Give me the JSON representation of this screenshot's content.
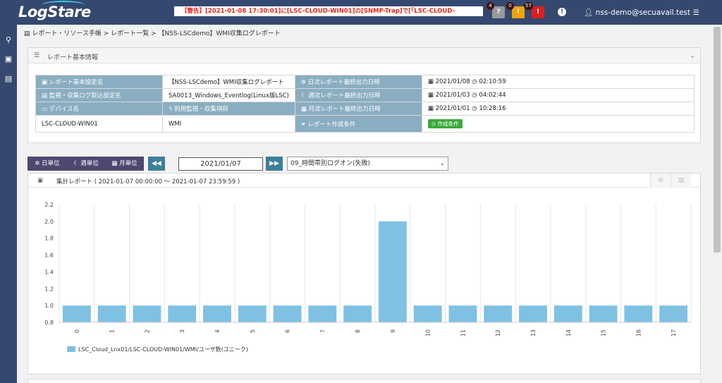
{
  "app": {
    "logo": "LogStare"
  },
  "topbar": {
    "alert": "【警告】[2021-01-08 17:30:01]に[LSC-CLOUD-WIN01]の[SNMP-Trap]で[「LSC-CLOUD-",
    "badges": [
      {
        "count": "4",
        "glyph": "?",
        "color": "#9a9a9a"
      },
      {
        "count": "0",
        "glyph": "!",
        "color": "#f0a20c"
      },
      {
        "count": "57",
        "glyph": "!",
        "color": "#d9201f"
      }
    ],
    "info_glyph": "!",
    "user": "nss-demo@secuavail.test"
  },
  "sidebar": {
    "icons": [
      "search-icon",
      "report-icon",
      "document-icon"
    ]
  },
  "breadcrumb": "レポート・リソース手帳 > レポート一覧 > 【NSS-LSCdemo】WMI収集ログレポート",
  "basic_info": {
    "title": "レポート基本情報",
    "rows": [
      {
        "l1": "レポート基本設定名",
        "v1": "【NSS-LSCdemo】WMI収集ログレポート",
        "l2": "日次レポート最終出力日時",
        "v2": "2021/01/08 ◷ 02:10:59"
      },
      {
        "l1": "監視・収集ログ取込設定名",
        "v1": "SA0013_Windows_Eventlog(Linux版LSC)",
        "l2": "週次レポート最終出力日時",
        "v2": "2021/01/03 ◷ 04:02:44"
      },
      {
        "l1": "デバイス名",
        "v1": "ϟ 利用監視・収集項目",
        "l2": "月次レポート最終出力日時",
        "v2": "2021/01/01 ◷ 10:28:16"
      },
      {
        "l1": "LSC-CLOUD-WIN01",
        "v1": "WMI",
        "l2": "レポート作成条件",
        "v2": "⊙ 作成条件"
      }
    ]
  },
  "controls": {
    "daily": "日単位",
    "weekly": "週単位",
    "monthly": "月単位",
    "prev": "◀◀",
    "next": "▶▶",
    "date": "2021/01/07",
    "report": "09_時間帯別ログオン(失敗)"
  },
  "report_panel": {
    "title": "集計レポート ( 2021-01-07 00:00:00 ～ 2021-01-07 23:59:59 )"
  },
  "chart_data": {
    "type": "bar",
    "categories": [
      "0",
      "1",
      "2",
      "3",
      "4",
      "5",
      "6",
      "7",
      "8",
      "9",
      "10",
      "11",
      "12",
      "13",
      "14",
      "15",
      "16",
      "17"
    ],
    "series": [
      {
        "name": "LSC_Cloud_Lnx01/LSC-CLOUD-WIN01/WMI/ユーザ数(ユニーク)",
        "values": [
          1,
          1,
          1,
          1,
          1,
          1,
          1,
          1,
          1,
          2,
          1,
          1,
          1,
          1,
          1,
          1,
          1,
          1
        ]
      }
    ],
    "ylim": [
      0.8,
      2.2
    ],
    "yticks": [
      "0.8",
      "1.0",
      "1.2",
      "1.4",
      "1.6",
      "1.8",
      "2.0",
      "2.2"
    ],
    "grid": "vertical",
    "legend": "bottom-left",
    "bar_color": "#7fc1e3"
  }
}
